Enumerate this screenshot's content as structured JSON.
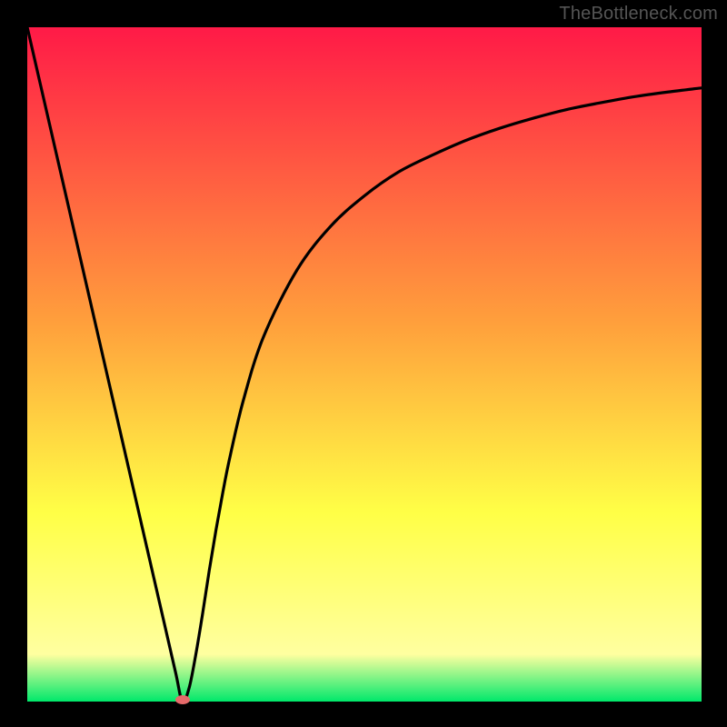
{
  "watermark": "TheBottleneck.com",
  "colors": {
    "red": "#ff1a47",
    "orange": "#ffa03c",
    "yellow": "#ffff46",
    "yellow_pale": "#ffffa0",
    "green": "#00e86b",
    "curve": "#000000",
    "marker": "#e66a6a",
    "frame": "#000000"
  },
  "chart_data": {
    "type": "line",
    "title": "",
    "xlabel": "",
    "ylabel": "",
    "xlim": [
      0,
      100
    ],
    "ylim": [
      0,
      100
    ],
    "x": [
      0,
      2,
      4,
      6,
      8,
      10,
      12,
      14,
      16,
      18,
      20,
      22,
      23,
      24,
      25,
      26,
      27,
      28,
      29,
      30,
      32,
      35,
      40,
      45,
      50,
      55,
      60,
      65,
      70,
      75,
      80,
      85,
      90,
      95,
      100
    ],
    "y": [
      100,
      91.3,
      82.6,
      73.9,
      65.2,
      56.5,
      47.8,
      39.1,
      30.4,
      21.7,
      13.0,
      4.3,
      0,
      2.0,
      7.0,
      13.0,
      19.5,
      25.5,
      31.0,
      36.0,
      44.5,
      54.0,
      64.0,
      70.5,
      75.0,
      78.5,
      81.0,
      83.2,
      85.0,
      86.5,
      87.8,
      88.8,
      89.7,
      90.4,
      91.0
    ],
    "annotations": [
      {
        "type": "marker",
        "x": 23,
        "y": 0,
        "shape": "ellipse"
      }
    ],
    "grid": false,
    "legend": null
  }
}
